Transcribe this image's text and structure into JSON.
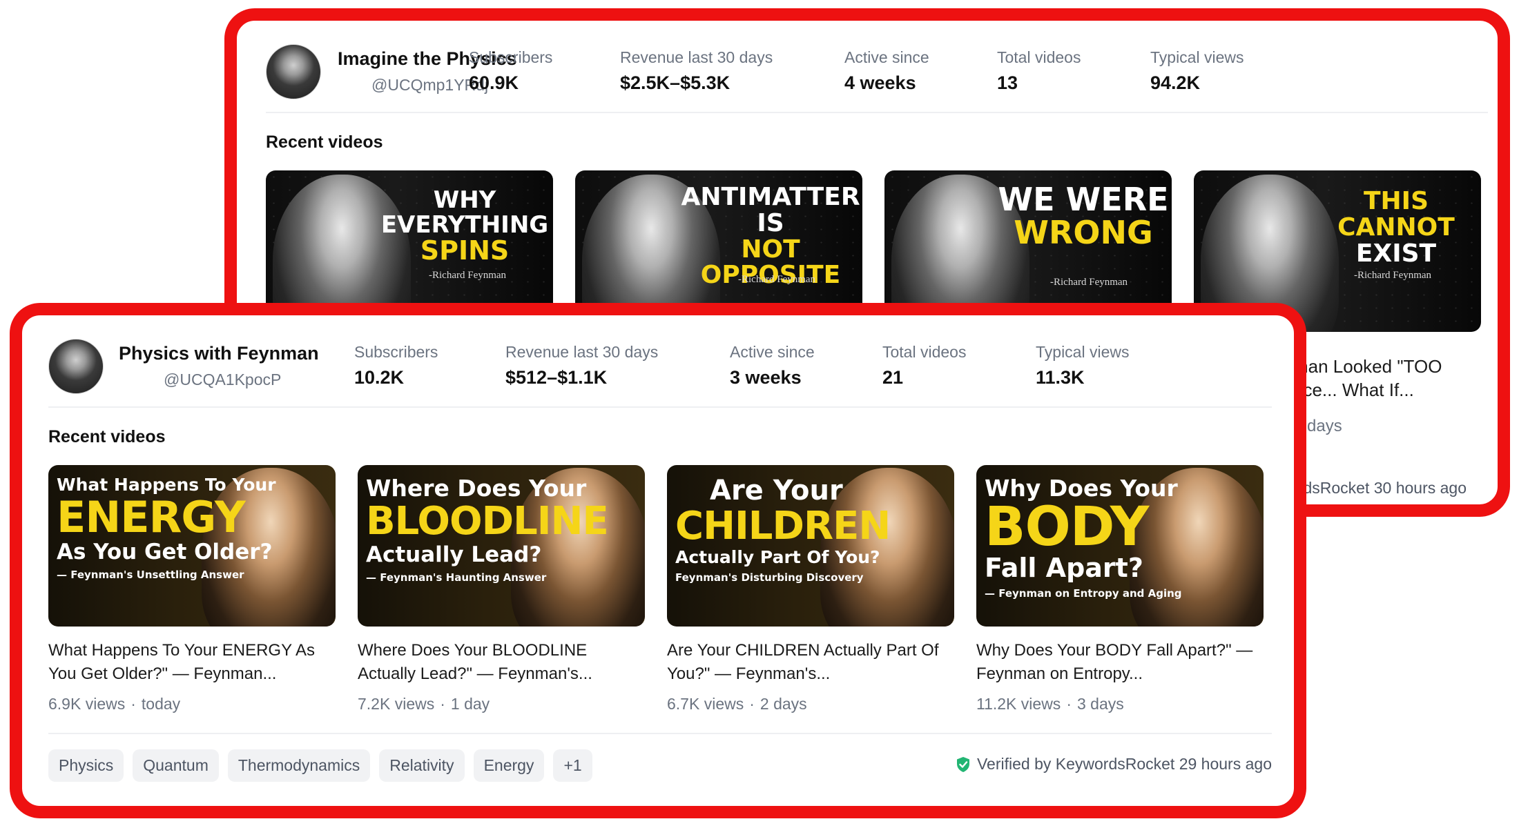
{
  "back_card": {
    "channel_name": "Imagine the Physics",
    "handle": "@UCQmp1YRdj",
    "stats": [
      {
        "label": "Subscribers",
        "value": "60.9K"
      },
      {
        "label": "Revenue last 30 days",
        "value": "$2.5K–$5.3K"
      },
      {
        "label": "Active since",
        "value": "4 weeks"
      },
      {
        "label": "Total videos",
        "value": "13"
      },
      {
        "label": "Typical views",
        "value": "94.2K"
      }
    ],
    "section_title": "Recent videos",
    "thumbnails": [
      {
        "line1": "WHY EVERYTHING",
        "line2": "SPINS",
        "signature": "-Richard Feynman"
      },
      {
        "line1": "ANTIMATTER IS",
        "line2": "NOT OPPOSITE",
        "signature": "-Richard Feynman"
      },
      {
        "line1": "WE WERE",
        "line2": "WRONG",
        "signature": "-Richard Feynman"
      },
      {
        "line1": "THIS CANNOT",
        "line2": "EXIST",
        "signature": "-Richard Feynman"
      }
    ],
    "peek_title_line1": "man Looked \"TOO",
    "peek_title_line2": "ace... What If...",
    "peek_meta": "0 days",
    "peek_verified": "dsRocket 30 hours ago"
  },
  "front_card": {
    "channel_name": "Physics with Feynman",
    "handle": "@UCQA1KpocP",
    "stats": [
      {
        "label": "Subscribers",
        "value": "10.2K"
      },
      {
        "label": "Revenue last 30 days",
        "value": "$512–$1.1K"
      },
      {
        "label": "Active since",
        "value": "3 weeks"
      },
      {
        "label": "Total videos",
        "value": "21"
      },
      {
        "label": "Typical views",
        "value": "11.3K"
      }
    ],
    "section_title": "Recent videos",
    "videos": [
      {
        "thumb_l1": "What Happens To Your",
        "thumb_l2": "ENERGY",
        "thumb_l3": "As You Get Older?",
        "thumb_l4": "— Feynman's Unsettling Answer",
        "title": "What Happens To Your ENERGY As You Get Older?\" — Feynman...",
        "views": "6.9K views",
        "age": "today"
      },
      {
        "thumb_l1": "Where Does Your",
        "thumb_l2": "BLOODLINE",
        "thumb_l3": "Actually Lead?",
        "thumb_l4": "— Feynman's Haunting Answer",
        "title": "Where Does Your BLOODLINE Actually Lead?\" — Feynman's...",
        "views": "7.2K views",
        "age": "1 day"
      },
      {
        "thumb_l1": "Are Your",
        "thumb_l2": "CHILDREN",
        "thumb_l3": "Actually Part Of You?",
        "thumb_l4": "Feynman's Disturbing Discovery",
        "title": "Are Your CHILDREN Actually Part Of You?\" — Feynman's...",
        "views": "6.7K views",
        "age": "2 days"
      },
      {
        "thumb_l1": "Why Does Your",
        "thumb_l2": "BODY",
        "thumb_l3": "Fall Apart?",
        "thumb_l4": "— Feynman on Entropy and Aging",
        "title": "Why Does Your BODY Fall Apart?\" — Feynman on Entropy...",
        "views": "11.2K views",
        "age": "3 days"
      }
    ],
    "tags": [
      "Physics",
      "Quantum",
      "Thermodynamics",
      "Relativity",
      "Energy",
      "+1"
    ],
    "verified_text": "Verified by KeywordsRocket 29 hours ago",
    "separator": "·"
  },
  "colors": {
    "frame_red": "#ee1111",
    "title_yellow": "#f5d518",
    "verified_green": "#22b573"
  }
}
